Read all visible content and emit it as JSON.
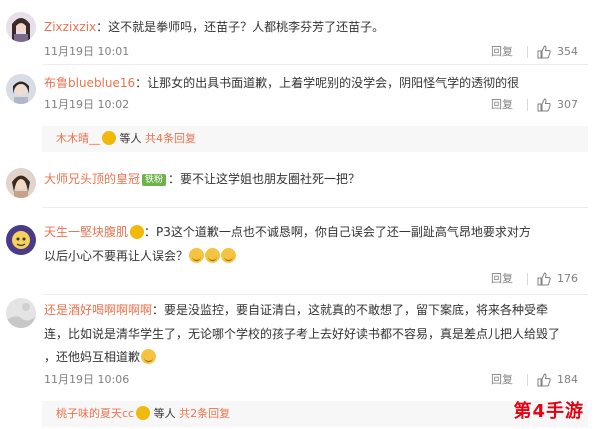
{
  "comments": [
    {
      "username": "Zixzixzix",
      "text": "：这不就是拳师吗，还苗子？人都桃李芬芳了还苗子。",
      "time": "11月19日 10:01",
      "reply": "回复",
      "likes": "354"
    },
    {
      "username": "布鲁blueblue16",
      "text": "：让那女的出具书面道歉，上着学呢别的没学会，阴阳怪气学的透彻的很",
      "time": "11月19日 10:02",
      "reply": "回复",
      "likes": "307",
      "sub_reply": {
        "user": "木木晴__",
        "suffix": "等人",
        "count": "共4条回复"
      }
    },
    {
      "username": "大师兄头顶的皇冠",
      "badge": "铁粉",
      "text": "：要不让这学姐也朋友圈社死一把？"
    },
    {
      "username": "天生一堅块腹肌",
      "text_1": "：P3这个道歉一点也不诚恳啊，你自己误会了还一副趾高气昂地要求对方",
      "text_2": "以后小心不要再让人误会？",
      "reply": "回复",
      "likes": "176"
    },
    {
      "username": "还是酒好喝啊啊啊啊",
      "text_1": "：要是没监控，要自证清白，这就真的不敢想了，留下案底，将来各种受牵",
      "text_2": "连，比如说是清华学生了，无论哪个学校的孩子考上去好好读书都不容易，真是差点儿把人给毁了",
      "text_3": "，还他妈互相道歉",
      "time": "11月19日 10:06",
      "reply": "回复",
      "likes": "184",
      "sub_reply": {
        "user": "桃子味的夏天cc",
        "suffix": "等人",
        "count": "共2条回复"
      }
    }
  ],
  "watermark": "第4手游",
  "colors": {
    "username": "#eb7350",
    "meta": "#808080",
    "accent": "#eb7350"
  }
}
